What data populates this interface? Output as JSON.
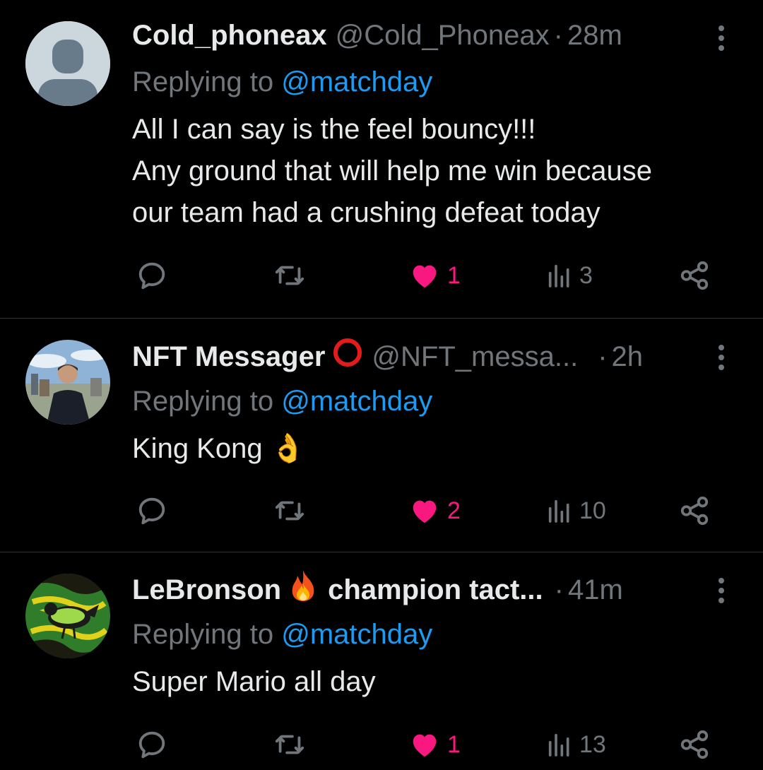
{
  "colors": {
    "background": "#000000",
    "primary_text": "#e7e9ea",
    "secondary_text": "#71767b",
    "mention": "#1d9bf0",
    "like_active": "#f91880",
    "divider": "#2f3336"
  },
  "tweets": [
    {
      "display_name": "Cold_phoneax",
      "handle": "@Cold_Phoneax",
      "separator": "·",
      "time": "28m",
      "reply_prefix": "Replying to",
      "reply_mention": "@matchday",
      "text_lines": [
        "All I can say is the feel bouncy!!!",
        "Any ground that will help me win because",
        "our team had a crushing defeat today"
      ],
      "likes": "1",
      "views": "3",
      "avatar": "default-profile-avatar",
      "badge_icon": null
    },
    {
      "display_name": "NFT Messager",
      "handle": "@NFT_messa...",
      "separator": "·",
      "time": "2h",
      "reply_prefix": "Replying to",
      "reply_mention": "@matchday",
      "text_lines": [
        "King Kong 👌"
      ],
      "likes": "2",
      "views": "10",
      "avatar": "profile-photo-man",
      "badge_icon": "red-circle-icon"
    },
    {
      "display_name": "LeBronson",
      "handle": "champion tact...",
      "separator": "·",
      "time": "41m",
      "reply_prefix": "Replying to",
      "reply_mention": "@matchday",
      "text_lines": [
        "Super Mario all day"
      ],
      "likes": "1",
      "views": "13",
      "avatar": "bird-illustration-avatar",
      "badge_icon": "fire-icon"
    }
  ]
}
